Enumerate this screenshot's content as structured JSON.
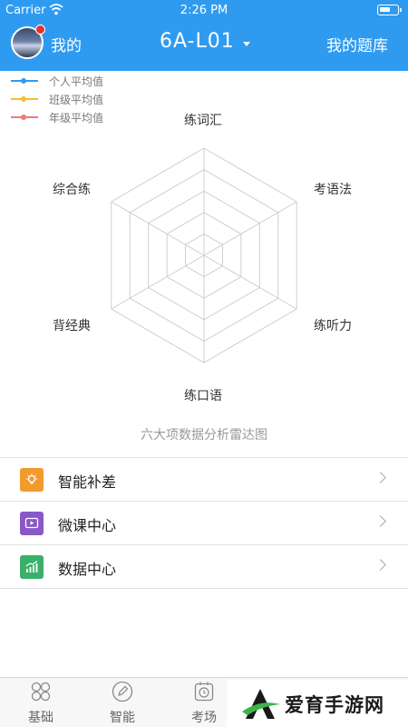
{
  "status_bar": {
    "carrier": "Carrier",
    "time": "2:26 PM"
  },
  "header": {
    "my_label": "我的",
    "unit_selector": "6A-L01",
    "question_bank": "我的题库"
  },
  "legend": [
    {
      "label": "个人平均值",
      "color": "#2f9bf0"
    },
    {
      "label": "班级平均值",
      "color": "#f5c02b"
    },
    {
      "label": "年级平均值",
      "color": "#f27a7a"
    }
  ],
  "chart_data": {
    "type": "radar",
    "title": "六大项数据分析雷达图",
    "axes": [
      "练词汇",
      "考语法",
      "练听力",
      "练口语",
      "背经典",
      "综合练"
    ],
    "rings": 5,
    "series": []
  },
  "menu": [
    {
      "label": "智能补差",
      "icon": "lightbulb-icon",
      "color": "#f39a2c"
    },
    {
      "label": "微课中心",
      "icon": "video-icon",
      "color": "#8a57c8"
    },
    {
      "label": "数据中心",
      "icon": "bar-chart-icon",
      "color": "#3bb06a"
    }
  ],
  "tabs": [
    {
      "label": "基础",
      "icon": "grid-petal-icon"
    },
    {
      "label": "智能",
      "icon": "pencil-icon"
    },
    {
      "label": "考场",
      "icon": "clock-icon"
    }
  ],
  "watermark": {
    "text": "爱育手游网"
  }
}
